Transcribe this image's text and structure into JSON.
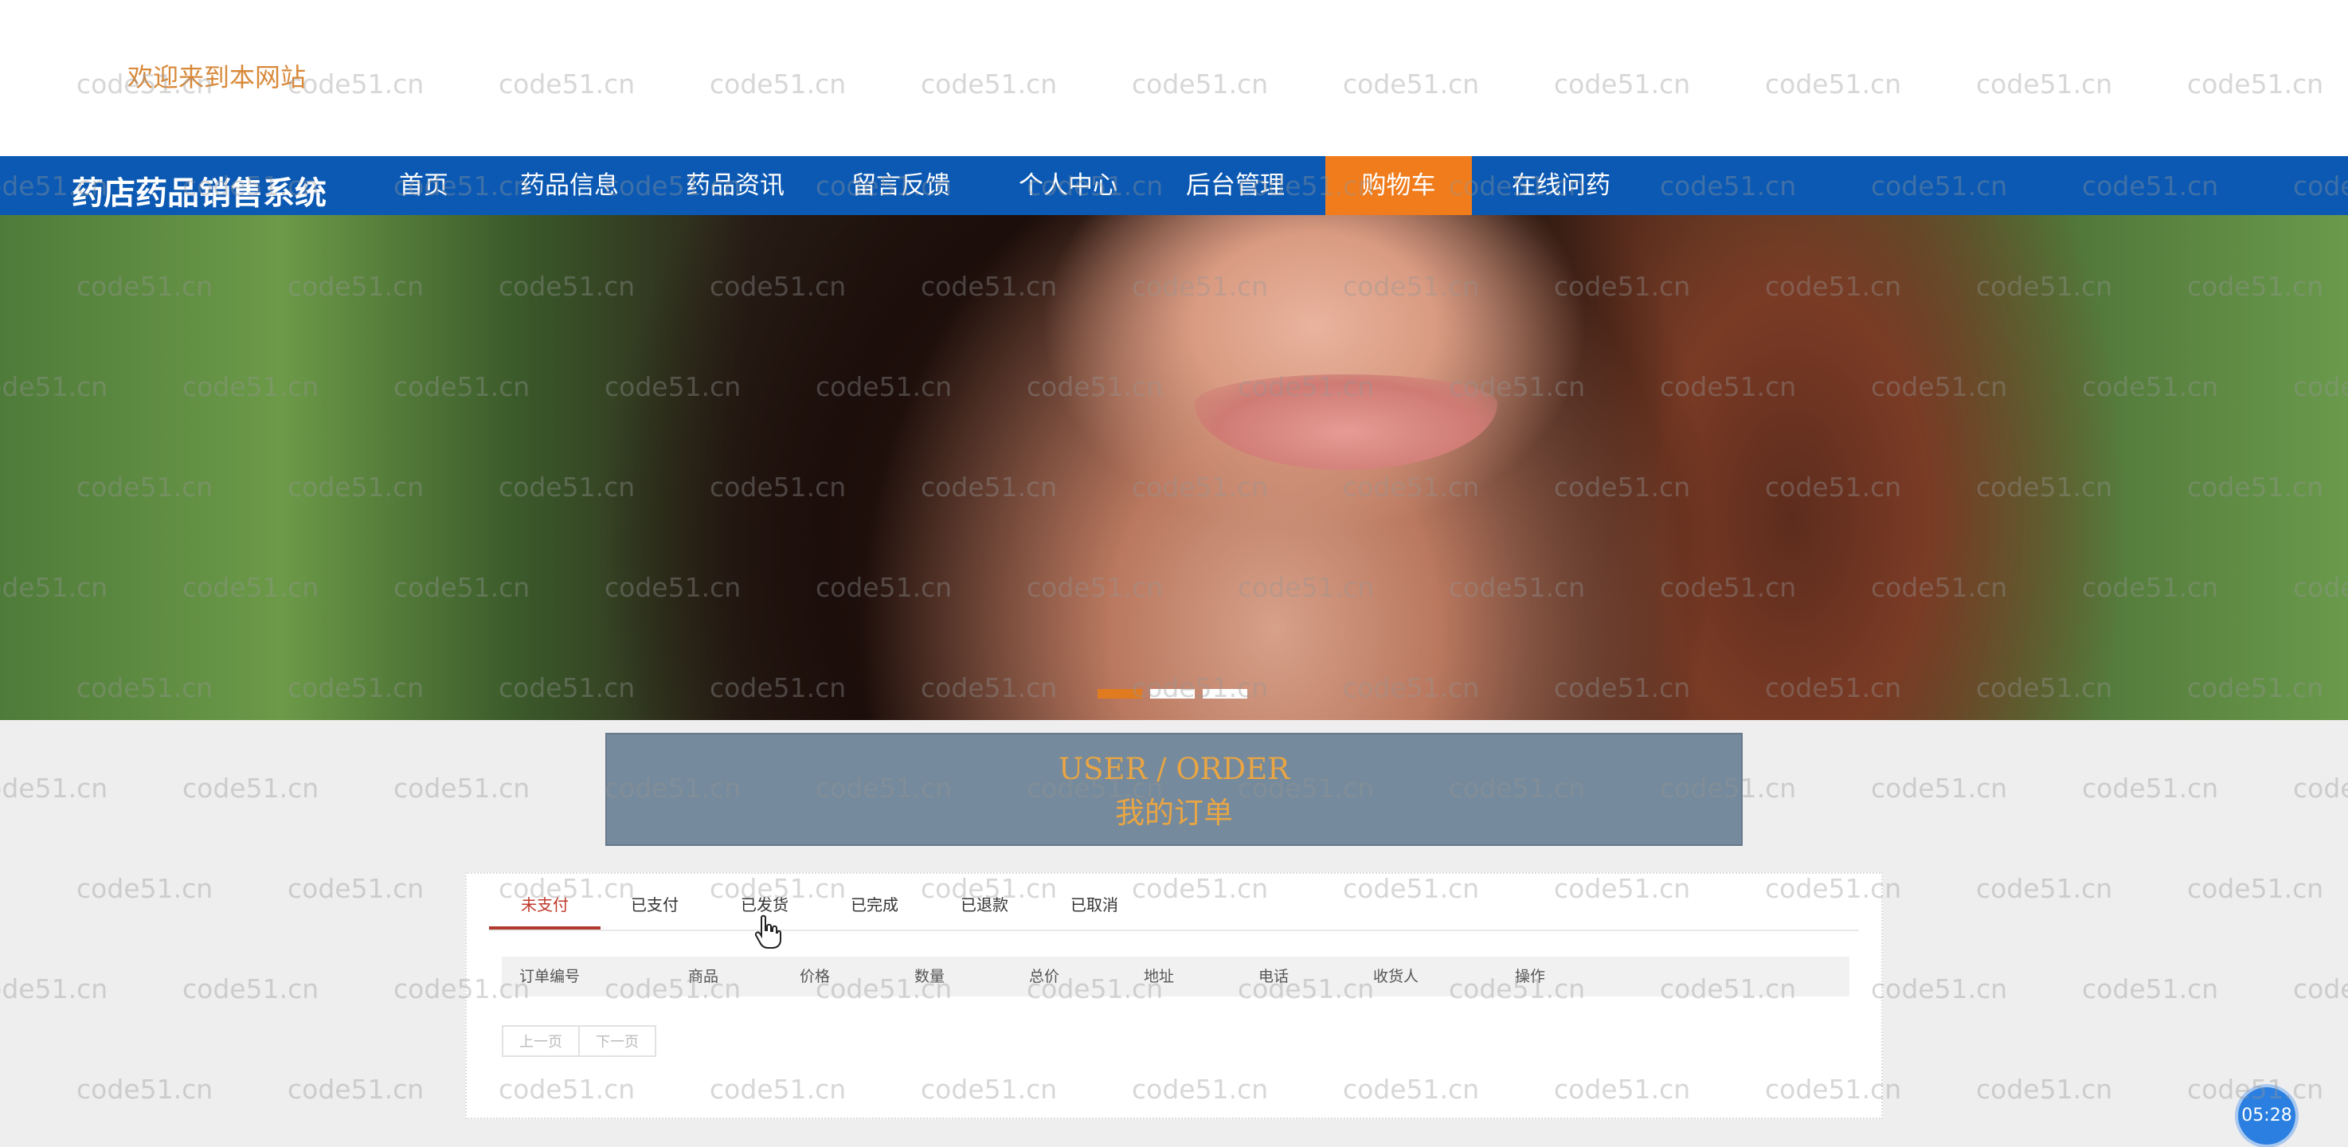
{
  "header": {
    "welcome": "欢迎来到本网站"
  },
  "nav": {
    "brand": "药店药品销售系统",
    "items": [
      {
        "label": "首页"
      },
      {
        "label": "药品信息"
      },
      {
        "label": "药品资讯"
      },
      {
        "label": "留言反馈"
      },
      {
        "label": "个人中心"
      },
      {
        "label": "后台管理"
      },
      {
        "label": "购物车",
        "active": true
      },
      {
        "label": "在线问药"
      }
    ]
  },
  "banner": {
    "slides": 3,
    "active_slide": 1
  },
  "order_header": {
    "title_en": "USER / ORDER",
    "title_cn": "我的订单"
  },
  "tabs": [
    {
      "label": "未支付",
      "active": true
    },
    {
      "label": "已支付"
    },
    {
      "label": "已发货"
    },
    {
      "label": "已完成"
    },
    {
      "label": "已退款"
    },
    {
      "label": "已取消"
    }
  ],
  "table": {
    "columns": [
      "订单编号",
      "商品",
      "价格",
      "数量",
      "总价",
      "地址",
      "电话",
      "收货人",
      "操作"
    ],
    "rows": []
  },
  "pager": {
    "prev": "上一页",
    "next": "下一页"
  },
  "timer": "05:28",
  "watermark": "code51.cn",
  "colors": {
    "nav_bg": "#0b59b3",
    "nav_active": "#f07c1c",
    "accent": "#d8893a",
    "tab_active": "#b03a2e"
  }
}
